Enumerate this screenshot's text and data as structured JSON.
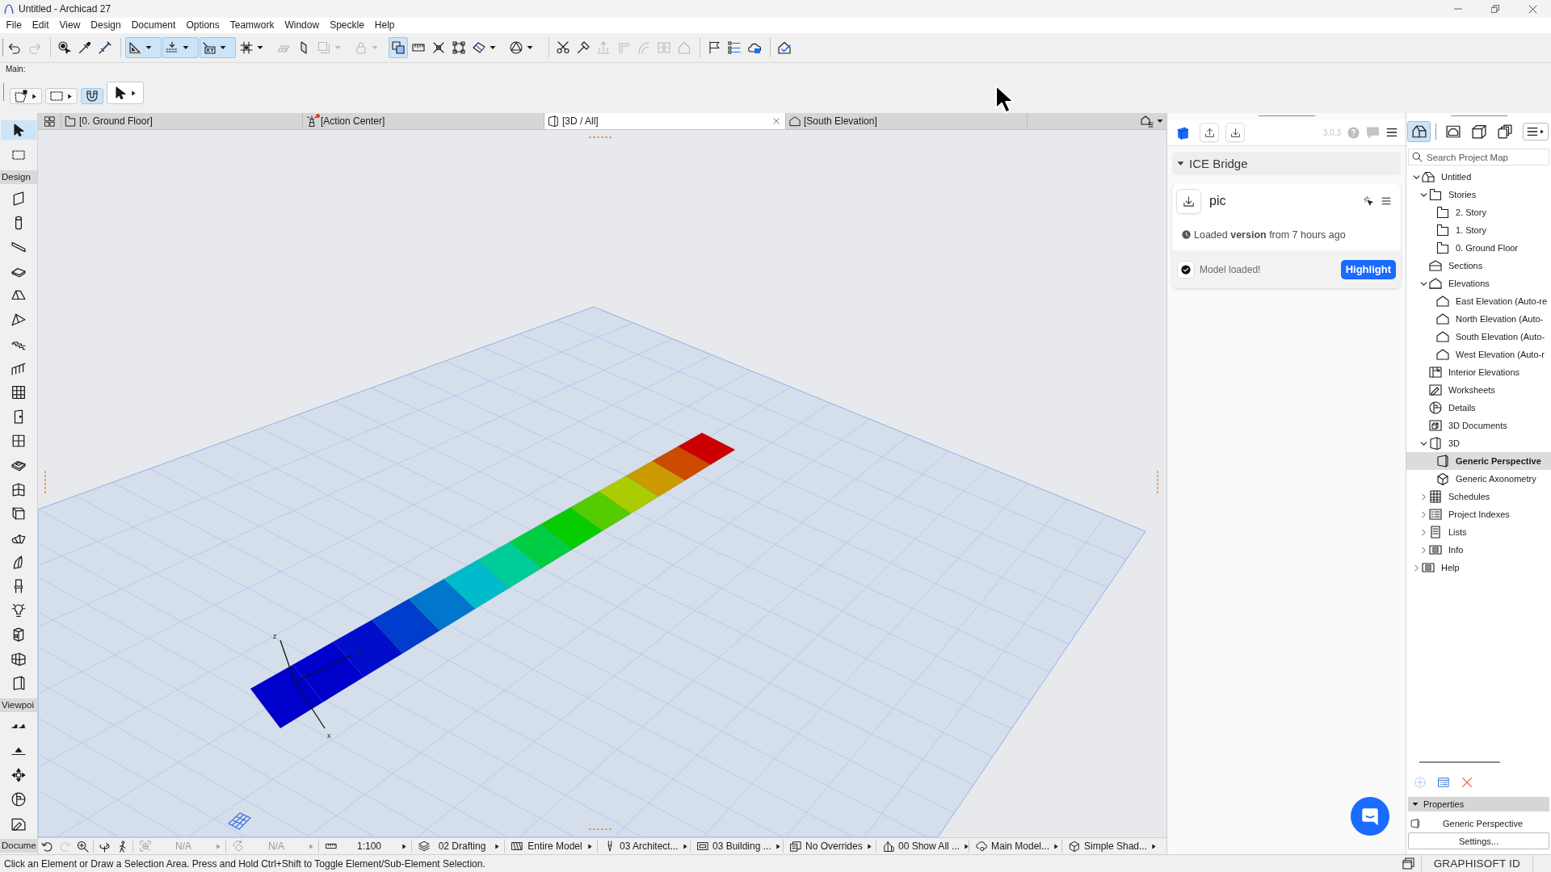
{
  "window": {
    "title": "Untitled - Archicad 27"
  },
  "menu": [
    "File",
    "Edit",
    "View",
    "Design",
    "Document",
    "Options",
    "Teamwork",
    "Window",
    "Speckle",
    "Help"
  ],
  "toolbar": [
    [
      {
        "kind": "undo",
        "on": false,
        "disabled": false,
        "dropdown": false
      },
      {
        "kind": "redo",
        "on": false,
        "disabled": true,
        "dropdown": false
      }
    ],
    [
      {
        "kind": "pick-up",
        "on": false,
        "disabled": false,
        "dropdown": false
      },
      {
        "kind": "eyedropper",
        "on": false,
        "disabled": false,
        "dropdown": false
      },
      {
        "kind": "syringe",
        "on": false,
        "disabled": false,
        "dropdown": false
      }
    ],
    [
      {
        "kind": "set-square",
        "on": true,
        "disabled": false,
        "dropdown": true
      },
      {
        "kind": "snap-line",
        "on": true,
        "disabled": false,
        "dropdown": true
      },
      {
        "kind": "xy-box",
        "on": true,
        "disabled": false,
        "dropdown": true
      },
      {
        "kind": "grid",
        "on": false,
        "disabled": false,
        "dropdown": true
      },
      {
        "kind": "plane",
        "on": false,
        "disabled": true,
        "dropdown": false
      },
      {
        "kind": "vertical-plane",
        "on": false,
        "disabled": false,
        "dropdown": false
      },
      {
        "kind": "square",
        "on": false,
        "disabled": true,
        "dropdown": true
      },
      {
        "kind": "lock",
        "on": false,
        "disabled": true,
        "dropdown": true
      },
      {
        "kind": "trace",
        "on": true,
        "disabled": false,
        "dropdown": false
      },
      {
        "kind": "ruler",
        "on": false,
        "disabled": false,
        "dropdown": false
      },
      {
        "kind": "cross",
        "on": false,
        "disabled": false,
        "dropdown": false
      },
      {
        "kind": "box-select",
        "on": false,
        "disabled": false,
        "dropdown": false
      },
      {
        "kind": "cutaway",
        "on": false,
        "disabled": false,
        "dropdown": true
      },
      {
        "kind": "circle-triangle",
        "on": false,
        "disabled": false,
        "dropdown": true
      }
    ],
    [
      {
        "kind": "scissors",
        "on": false,
        "disabled": false,
        "dropdown": false
      },
      {
        "kind": "hammer",
        "on": false,
        "disabled": false,
        "dropdown": false
      },
      {
        "kind": "elevate",
        "on": false,
        "disabled": true,
        "dropdown": false
      },
      {
        "kind": "corner",
        "on": false,
        "disabled": true,
        "dropdown": false
      },
      {
        "kind": "curve",
        "on": false,
        "disabled": true,
        "dropdown": false
      },
      {
        "kind": "split",
        "on": false,
        "disabled": true,
        "dropdown": false
      },
      {
        "kind": "house",
        "on": false,
        "disabled": true,
        "dropdown": false
      }
    ],
    [
      {
        "kind": "flag",
        "on": false,
        "disabled": false,
        "dropdown": false
      },
      {
        "kind": "list",
        "on": false,
        "disabled": false,
        "dropdown": false
      },
      {
        "kind": "cloud",
        "on": false,
        "disabled": false,
        "dropdown": false
      }
    ],
    [
      {
        "kind": "house-check",
        "on": false,
        "disabled": false,
        "dropdown": false
      }
    ]
  ],
  "main_toolbar": {
    "label": "Main:",
    "buttons": [
      {
        "kind": "poly-marquee",
        "on": false,
        "dropdown": true
      },
      {
        "kind": "marquee",
        "on": false,
        "dropdown": true
      },
      {
        "kind": "magnet",
        "on": true,
        "dropdown": false
      },
      {
        "kind": "pointer",
        "on": false,
        "dropdown": true
      }
    ]
  },
  "tabs": [
    {
      "kind": "plan",
      "label": "[0. Ground Floor]",
      "selected": false,
      "alert": false
    },
    {
      "kind": "lighthouse",
      "label": "[Action Center]",
      "selected": false,
      "alert": true
    },
    {
      "kind": "prism",
      "label": "[3D / All]",
      "selected": true,
      "alert": false
    },
    {
      "kind": "elevation",
      "label": "[South Elevation]",
      "selected": false,
      "alert": false
    }
  ],
  "toolbox": {
    "tools": [
      {
        "kind": "pointer",
        "selected": true
      },
      {
        "kind": "marquee",
        "selected": false
      }
    ],
    "sections": [
      {
        "label": "Design",
        "tools": [
          {
            "kind": "wall",
            "selected": false
          },
          {
            "kind": "column",
            "selected": false
          },
          {
            "kind": "beam",
            "selected": false
          },
          {
            "kind": "slab",
            "selected": false
          },
          {
            "kind": "roof",
            "selected": false
          },
          {
            "kind": "shell",
            "selected": false
          },
          {
            "kind": "stair",
            "selected": false
          },
          {
            "kind": "railing",
            "selected": false
          },
          {
            "kind": "curtain-wall",
            "selected": false
          },
          {
            "kind": "door",
            "selected": false
          },
          {
            "kind": "window",
            "selected": false
          },
          {
            "kind": "skylight",
            "selected": false
          },
          {
            "kind": "corner-window",
            "selected": false
          },
          {
            "kind": "wall-end",
            "selected": false
          },
          {
            "kind": "mesh",
            "selected": false
          },
          {
            "kind": "morph",
            "selected": false
          },
          {
            "kind": "chair",
            "selected": false
          },
          {
            "kind": "lamp",
            "selected": false
          },
          {
            "kind": "zone",
            "selected": false
          },
          {
            "kind": "panel-grid",
            "selected": false
          },
          {
            "kind": "opening",
            "selected": false
          }
        ]
      },
      {
        "label": "Viewpoi",
        "tools": [
          {
            "kind": "section-marker",
            "selected": false
          },
          {
            "kind": "elevation-marker",
            "selected": false
          },
          {
            "kind": "interior-marker",
            "selected": false
          },
          {
            "kind": "detail-marker",
            "selected": false
          },
          {
            "kind": "worksheet",
            "selected": false
          }
        ]
      },
      {
        "label": "Docume"
      }
    ]
  },
  "viewport": {
    "axes": [
      {
        "label": "z"
      },
      {
        "label": "y"
      },
      {
        "label": "x"
      }
    ]
  },
  "view_bar": {
    "nav": [
      [
        {
          "kind": "undo-view",
          "disabled": false
        },
        {
          "kind": "redo-view",
          "disabled": true
        },
        {
          "kind": "zoom-in",
          "disabled": false
        }
      ],
      [
        {
          "kind": "orbit",
          "disabled": false
        },
        {
          "kind": "walk",
          "disabled": false
        }
      ]
    ],
    "settings": [
      {
        "kind": "zoom-fit",
        "value": "N/A",
        "disabled": true
      },
      {
        "kind": "rotate",
        "value": "N/A",
        "disabled": true
      },
      {
        "kind": "scale",
        "value": "1:100",
        "disabled": false
      },
      {
        "kind": "layers",
        "value": "02 Drafting",
        "disabled": false
      },
      {
        "kind": "model-filter",
        "value": "Entire Model",
        "disabled": false
      },
      {
        "kind": "pen",
        "value": "03 Architect...",
        "disabled": false
      },
      {
        "kind": "dimension",
        "value": "03 Building ...",
        "disabled": false
      },
      {
        "kind": "override",
        "value": "No Overrides",
        "disabled": false
      },
      {
        "kind": "renovation",
        "value": "00 Show All ...",
        "disabled": false
      },
      {
        "kind": "structure",
        "value": "Main Model...",
        "disabled": false
      },
      {
        "kind": "cube",
        "value": "Simple Shad...",
        "disabled": false
      }
    ]
  },
  "speckle": {
    "version": "3.0.3",
    "project": {
      "name": "ICE Bridge",
      "expanded": true,
      "models": [
        {
          "name": "pic",
          "status": "Loaded **version** from 7 hours ago",
          "message": "Model loaded!",
          "action": "Highlight"
        }
      ]
    }
  },
  "navigator": {
    "tabs": [
      {
        "kind": "project-map",
        "selected": true
      },
      {
        "kind": "view-map",
        "selected": false
      },
      {
        "kind": "layout-book",
        "selected": false
      },
      {
        "kind": "publisher",
        "selected": false
      }
    ],
    "search": {
      "placeholder": "Search Project Map"
    },
    "tree": [
      {
        "kind": "project",
        "label": "Untitled",
        "expanded": true,
        "selected": false,
        "children": [
          {
            "kind": "stories",
            "label": "Stories",
            "expanded": true,
            "selected": false,
            "children": [
              {
                "kind": "story",
                "label": "2. Story",
                "selected": false
              },
              {
                "kind": "story",
                "label": "1. Story",
                "selected": false
              },
              {
                "kind": "story",
                "label": "0. Ground Floor",
                "selected": false
              }
            ]
          },
          {
            "kind": "sections",
            "label": "Sections",
            "selected": false
          },
          {
            "kind": "elevations",
            "label": "Elevations",
            "expanded": true,
            "selected": false,
            "children": [
              {
                "kind": "elevation",
                "label": "East Elevation (Auto-re",
                "selected": false
              },
              {
                "kind": "elevation",
                "label": "North Elevation (Auto-",
                "selected": false
              },
              {
                "kind": "elevation",
                "label": "South Elevation (Auto-",
                "selected": false
              },
              {
                "kind": "elevation",
                "label": "West Elevation (Auto-r",
                "selected": false
              }
            ]
          },
          {
            "kind": "interior-elevations",
            "label": "Interior Elevations",
            "selected": false
          },
          {
            "kind": "worksheets",
            "label": "Worksheets",
            "selected": false
          },
          {
            "kind": "details",
            "label": "Details",
            "selected": false
          },
          {
            "kind": "documents-3d",
            "label": "3D Documents",
            "selected": false
          },
          {
            "kind": "prism",
            "label": "3D",
            "expanded": true,
            "selected": false,
            "children": [
              {
                "kind": "perspective",
                "label": "Generic Perspective",
                "selected": true
              },
              {
                "kind": "cube",
                "label": "Generic Axonometry",
                "selected": false
              }
            ]
          },
          {
            "kind": "schedules",
            "label": "Schedules",
            "expanded": false,
            "selected": false
          },
          {
            "kind": "indexes",
            "label": "Project Indexes",
            "expanded": false,
            "selected": false
          },
          {
            "kind": "lists",
            "label": "Lists",
            "expanded": false,
            "selected": false
          },
          {
            "kind": "info",
            "label": "Info",
            "expanded": false,
            "selected": false
          }
        ]
      },
      {
        "kind": "info",
        "label": "Help",
        "expanded": false,
        "selected": false
      }
    ],
    "actions": [
      {
        "kind": "add-circle",
        "disabled": true
      },
      {
        "kind": "list-settings",
        "disabled": false
      },
      {
        "kind": "delete-x",
        "disabled": false
      }
    ],
    "properties": {
      "title": "Properties",
      "expanded": true,
      "view": "Generic Perspective",
      "button": "Settings..."
    }
  },
  "status_bar": {
    "message": "Click an Element or Draw a Selection Area. Press and Hold Ctrl+Shift to Toggle Element/Sub-Element Selection.",
    "account": "GRAPHISOFT ID"
  }
}
